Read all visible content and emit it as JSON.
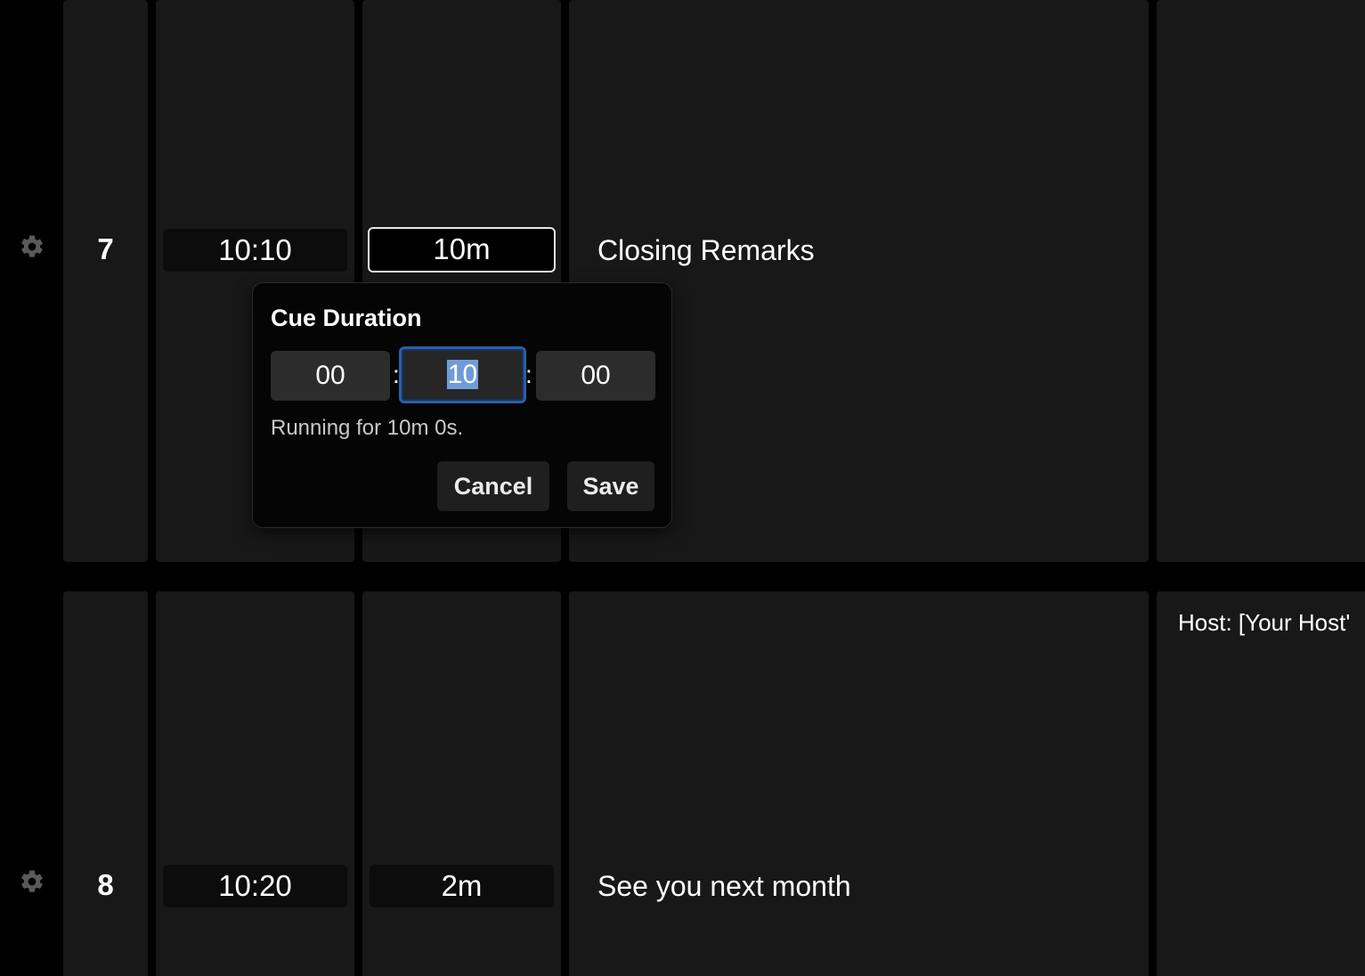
{
  "rows": [
    {
      "number": "7",
      "start_time": "10:10",
      "duration": "10m",
      "title": "Closing Remarks",
      "note": ""
    },
    {
      "number": "8",
      "start_time": "10:20",
      "duration": "2m",
      "title": "See you next month",
      "note": "Host: [Your Host'"
    }
  ],
  "icons": {
    "row_settings": "gear-icon"
  },
  "duration_popover": {
    "title": "Cue Duration",
    "hours": "00",
    "minutes": "10",
    "seconds": "00",
    "separator": ":",
    "hint": "Running for 10m 0s.",
    "cancel_label": "Cancel",
    "save_label": "Save"
  },
  "colors": {
    "background": "#000000",
    "cell": "#181818",
    "focus_ring": "#2d5ea6",
    "selection": "#6f9cd8"
  }
}
